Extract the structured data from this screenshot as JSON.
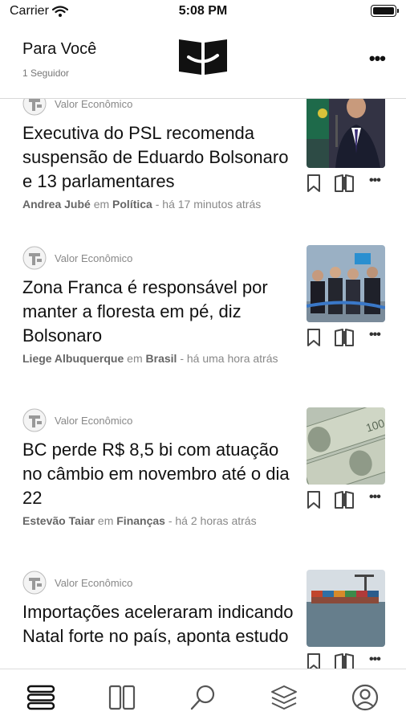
{
  "status": {
    "carrier": "Carrier",
    "time": "5:08 PM",
    "battery_level": 1.0
  },
  "header": {
    "title": "Para Você",
    "followers": "1 Seguidor",
    "logo_icon": "valor-logo-icon"
  },
  "articles": [
    {
      "source": "Valor Econômico",
      "headline": "Executiva do PSL recomenda suspensão de Eduardo Bolsonaro e 13 parlamentares",
      "author": "Andrea Jubé",
      "em": "em",
      "section": "Política",
      "time": "- há 17 minutos atrás",
      "image": "politician-speaking-photo"
    },
    {
      "source": "Valor Econômico",
      "headline": "Zona Franca é responsável por manter a floresta em pé, diz Bolsonaro",
      "author": "Liege Albuquerque",
      "em": "em",
      "section": "Brasil",
      "time": "- há uma hora atrás",
      "image": "officials-group-photo"
    },
    {
      "source": "Valor Econômico",
      "headline": "BC perde R$ 8,5 bi com atuação no câmbio em novembro até o dia 22",
      "author": "Estevão Taiar",
      "em": "em",
      "section": "Finanças",
      "time": "- há 2 horas atrás",
      "image": "dollar-bills-photo"
    },
    {
      "source": "Valor Econômico",
      "headline": "Importações aceleraram indicando Natal forte no país, aponta estudo",
      "author": "",
      "em": "",
      "section": "",
      "time": "",
      "image": "container-port-photo"
    }
  ],
  "tabs": [
    {
      "name": "feed",
      "icon": "stack-lines-icon"
    },
    {
      "name": "sections",
      "icon": "columns-icon"
    },
    {
      "name": "search",
      "icon": "search-icon"
    },
    {
      "name": "layers",
      "icon": "layers-icon"
    },
    {
      "name": "profile",
      "icon": "profile-icon"
    }
  ]
}
